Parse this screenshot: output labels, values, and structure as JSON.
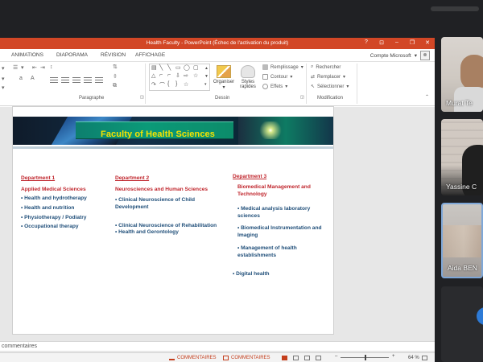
{
  "window": {
    "title": "Health Faculty - PowerPoint (Échec de l'activation du produit)",
    "controls": [
      "?",
      "⊡",
      "–",
      "❐",
      "✕"
    ]
  },
  "ribbon_tabs": [
    "ANIMATIONS",
    "DIAPORAMA",
    "RÉVISION",
    "AFFICHAGE"
  ],
  "account": {
    "label": "Compte Microsoft"
  },
  "ribbon": {
    "groups": {
      "paragraphe": "Paragraphe",
      "dessin": "Dessin",
      "modification": "Modification"
    },
    "dessin": {
      "organiser": "Organiser",
      "styles_rapides": "Styles rapides",
      "remplissage": "Remplissage",
      "contour": "Contour",
      "effets": "Effets"
    },
    "modification": {
      "rechercher": "Rechercher",
      "remplacer": "Remplacer",
      "selectionner": "Sélectionner"
    }
  },
  "slide": {
    "title": "Faculty of Health Sciences",
    "departments": [
      {
        "heading": "Department 1",
        "subheading": "Applied Medical Sciences",
        "items": [
          "Health and hydrotherapy",
          "Health and nutrition",
          "Physiotherapy / Podiatry",
          "Occupational therapy"
        ]
      },
      {
        "heading": "Department 2",
        "subheading": "Neurosciences and Human Sciences",
        "items": [
          "Clinical Neuroscience of Child Development",
          "Clinical Neuroscience of Rehabilitation",
          "Health and Gerontology"
        ]
      },
      {
        "heading": "Department 3",
        "subheading": "Biomedical Management and Technology",
        "items": [
          "Medical analysis laboratory sciences",
          "Biomedical Instrumentation and Imaging",
          "Management of health establishments",
          "Digital health"
        ]
      }
    ]
  },
  "notes": {
    "label": "commentaires"
  },
  "statusbar": {
    "notes_btn": "COMMENTAIRES",
    "comments_btn": "COMMENTAIRES",
    "zoom": "64 %"
  },
  "participants": [
    {
      "name": "Murat Te"
    },
    {
      "name": "Yassine C"
    },
    {
      "name": "Aida BEN"
    }
  ]
}
